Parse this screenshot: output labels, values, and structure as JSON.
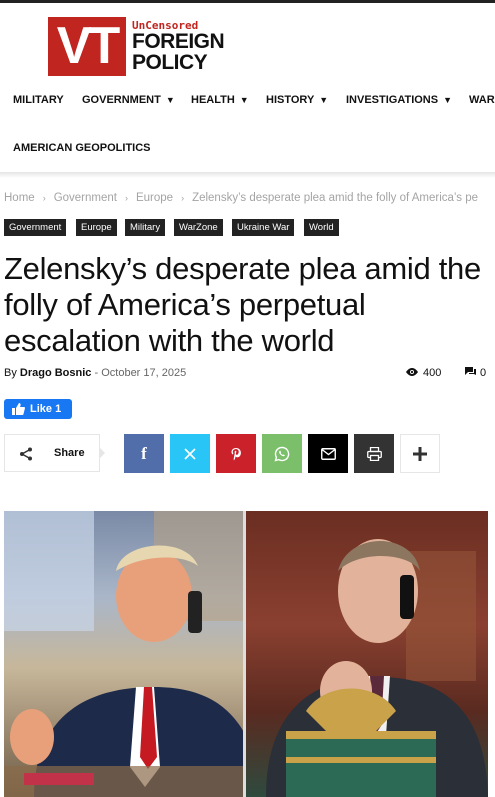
{
  "logo": {
    "mark": "VT",
    "tagline": "UnCensored",
    "name_line1": "FOREIGN",
    "name_line2": "POLICY"
  },
  "nav": {
    "items": [
      {
        "label": "MILITARY",
        "dropdown": false
      },
      {
        "label": "GOVERNMENT",
        "dropdown": true
      },
      {
        "label": "HEALTH",
        "dropdown": true
      },
      {
        "label": "HISTORY",
        "dropdown": true
      },
      {
        "label": "INVESTIGATIONS",
        "dropdown": true
      },
      {
        "label": "WAR",
        "dropdown": false
      },
      {
        "label": "AMERICAN GEOPOLITICS",
        "dropdown": false
      }
    ]
  },
  "breadcrumb": [
    "Home",
    "Government",
    "Europe",
    "Zelensky’s desperate plea amid the folly of America’s pe"
  ],
  "tags": [
    "Government",
    "Europe",
    "Military",
    "WarZone",
    "Ukraine War",
    "World"
  ],
  "article": {
    "title": "Zelensky’s desperate plea amid the folly of America’s perpetual escalation with the world",
    "by_label": "By",
    "author": "Drago Bosnic",
    "date_sep": "-",
    "date": "October 17, 2025",
    "views": "400",
    "comments": "0"
  },
  "facebook": {
    "like_label": "Like 1"
  },
  "share": {
    "label": "Share",
    "buttons": [
      {
        "name": "facebook",
        "glyph": "f",
        "color": "#516eab"
      },
      {
        "name": "x",
        "glyph": "𝕏",
        "color": "#29c5f6"
      },
      {
        "name": "pinterest",
        "glyph": "P",
        "color": "#ca212a"
      },
      {
        "name": "whatsapp",
        "glyph": "W",
        "color": "#7bbf6a"
      },
      {
        "name": "email",
        "glyph": "✉",
        "color": "#000000"
      },
      {
        "name": "print",
        "glyph": "⎙",
        "color": "#333333"
      },
      {
        "name": "more",
        "glyph": "+",
        "color": "#ffffff"
      }
    ]
  },
  "colors": {
    "brand_red": "#c0251f",
    "tag_bg": "#222222",
    "facebook_blue": "#1877f2"
  }
}
